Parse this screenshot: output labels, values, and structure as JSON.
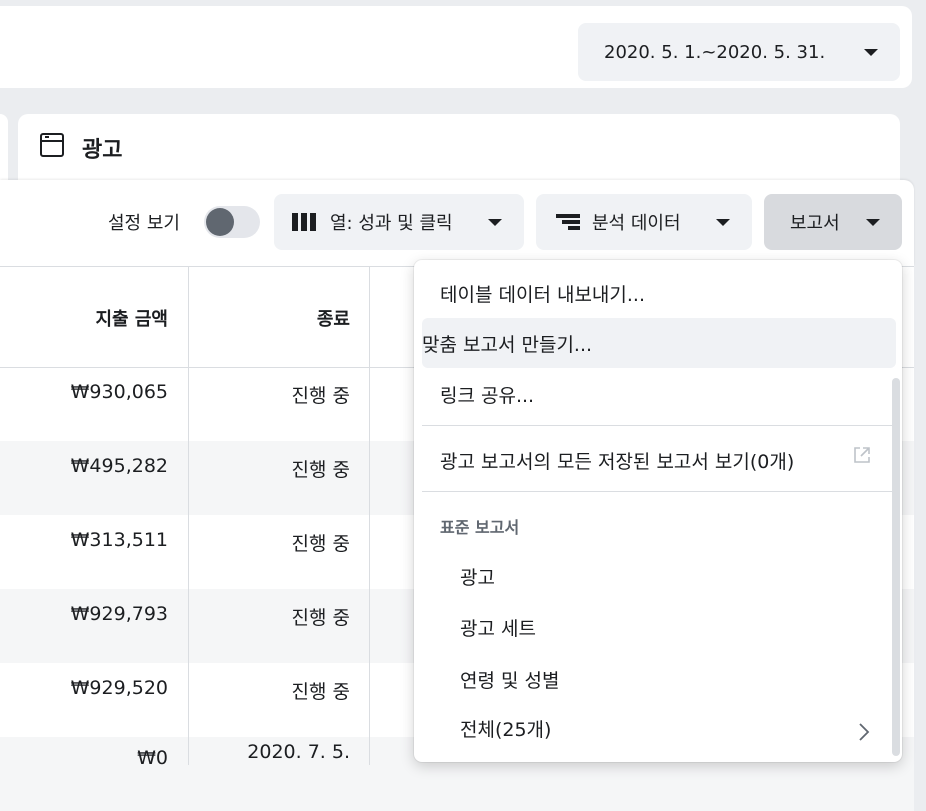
{
  "date_range": {
    "label": "2020. 5. 1.~2020. 5. 31."
  },
  "tab": {
    "title": "광고"
  },
  "toolbar": {
    "settings_label": "설정 보기",
    "columns_label": "열: 성과 및 클릭",
    "breakdown_label": "분석 데이터",
    "reports_label": "보고서"
  },
  "table": {
    "headers": {
      "amount": "지출 금액",
      "status": "종료"
    },
    "rows": [
      {
        "amount": "₩930,065",
        "status": "진행 중"
      },
      {
        "amount": "₩495,282",
        "status": "진행 중"
      },
      {
        "amount": "₩313,511",
        "status": "진행 중"
      },
      {
        "amount": "₩929,793",
        "status": "진행 중"
      },
      {
        "amount": "₩929,520",
        "status": "진행 중"
      },
      {
        "amount": "₩0",
        "status": "2020. 7. 5."
      }
    ]
  },
  "menu": {
    "export": "테이블 데이터 내보내기...",
    "custom": "맞춤 보고서 만들기...",
    "share": "링크 공유...",
    "saved": "광고 보고서의 모든 저장된 보고서 보기(0개)",
    "section_title": "표준 보고서",
    "standard": [
      "광고",
      "광고 세트",
      "연령 및 성별",
      "전체(25개)"
    ]
  }
}
